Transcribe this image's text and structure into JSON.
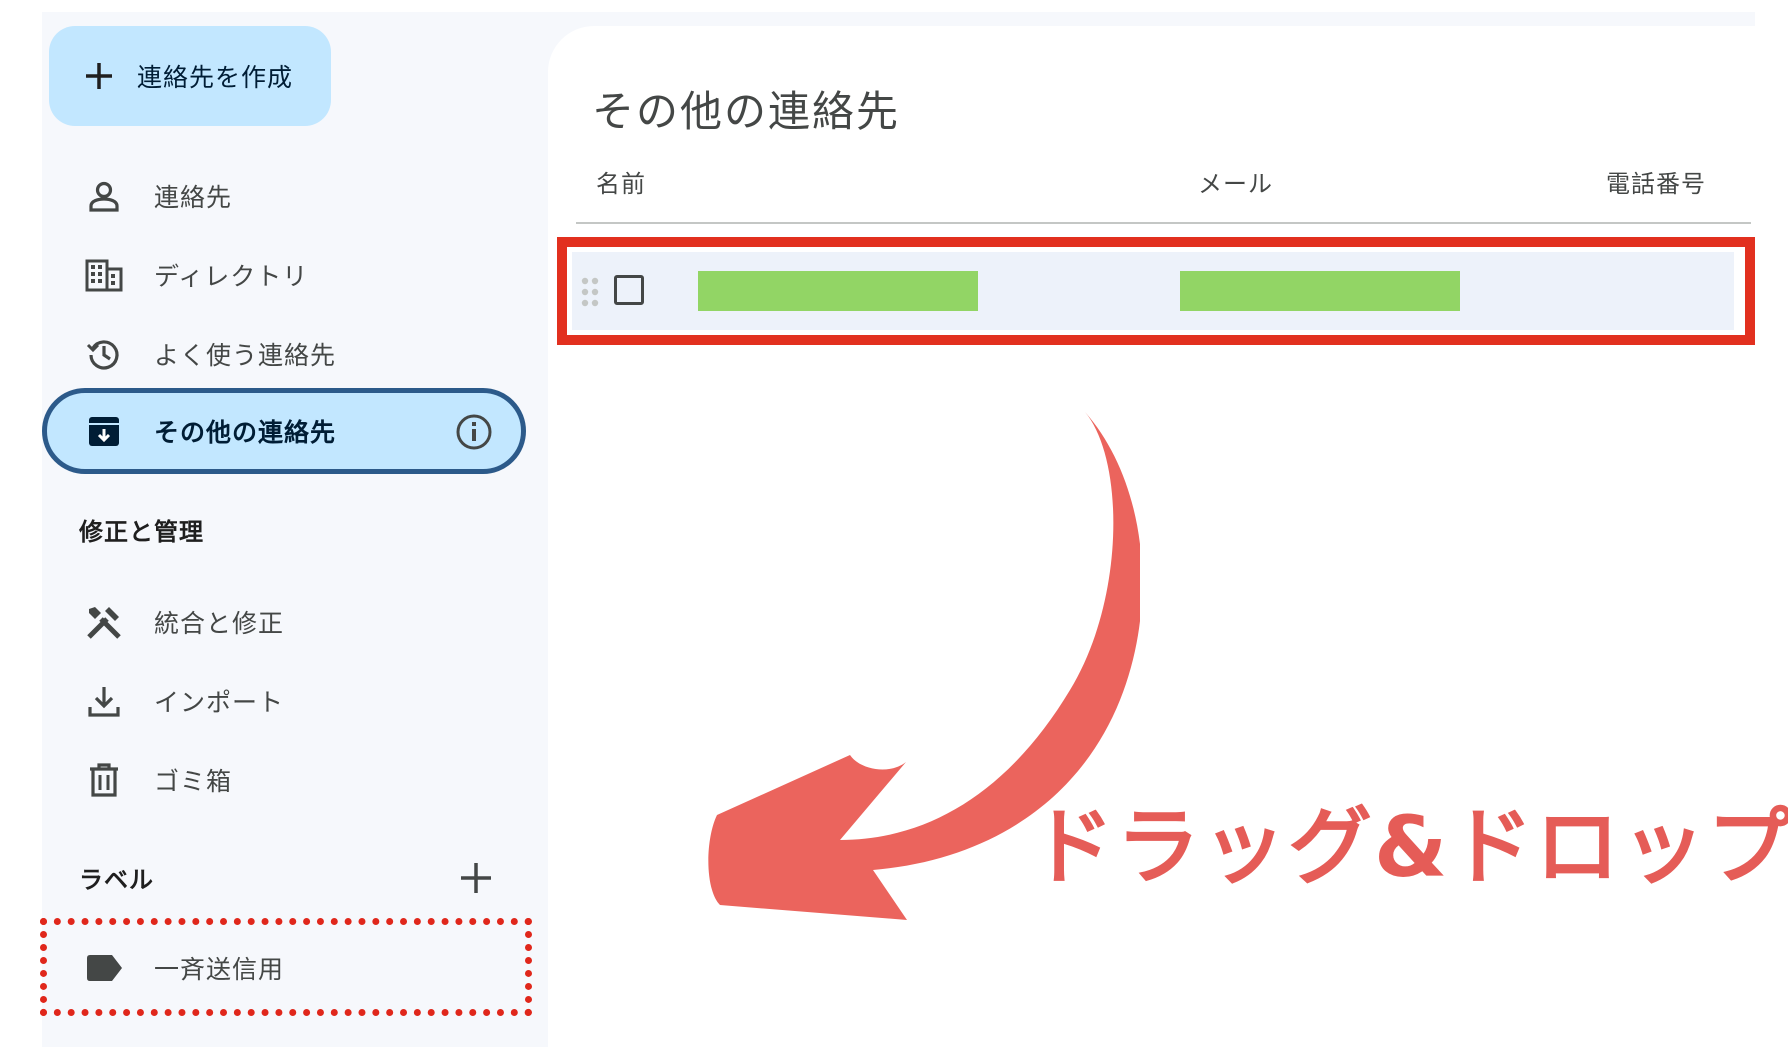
{
  "sidebar": {
    "create_button": "連絡先を作成",
    "items": [
      {
        "label": "連絡先",
        "icon": "person-icon"
      },
      {
        "label": "ディレクトリ",
        "icon": "building-icon"
      },
      {
        "label": "よく使う連絡先",
        "icon": "history-icon"
      },
      {
        "label": "その他の連絡先",
        "icon": "archive-download-icon",
        "active": true
      }
    ],
    "fix_section_title": "修正と管理",
    "fix_items": [
      {
        "label": "統合と修正",
        "icon": "tools-icon"
      },
      {
        "label": "インポート",
        "icon": "download-icon"
      },
      {
        "label": "ゴミ箱",
        "icon": "trash-icon"
      }
    ],
    "labels_section_title": "ラベル",
    "label_items": [
      {
        "label": "一斉送信用",
        "icon": "label-icon"
      }
    ]
  },
  "main": {
    "title": "その他の連絡先",
    "columns": {
      "name": "名前",
      "email": "メール",
      "phone": "電話番号"
    }
  },
  "annotation": {
    "text": "ドラッグ&ドロップ",
    "color": "#e55c57",
    "highlight_color": "#e2301f"
  },
  "colors": {
    "active_bg": "#c2e7ff",
    "active_border": "#2c5a8a",
    "redaction": "#92d565",
    "row_bg": "#edf2fa"
  }
}
